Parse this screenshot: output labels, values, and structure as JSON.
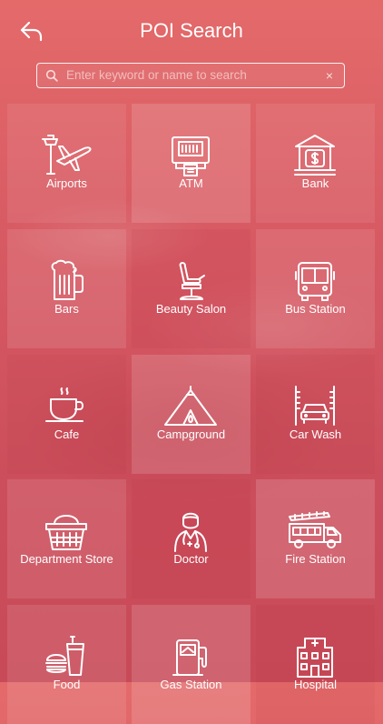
{
  "header": {
    "title": "POI Search"
  },
  "search": {
    "placeholder": "Enter keyword or name to search",
    "clear_glyph": "×"
  },
  "categories": [
    {
      "label": "Airports",
      "icon": "airport-icon"
    },
    {
      "label": "ATM",
      "icon": "atm-icon"
    },
    {
      "label": "Bank",
      "icon": "bank-icon"
    },
    {
      "label": "Bars",
      "icon": "beer-mug-icon"
    },
    {
      "label": "Beauty Salon",
      "icon": "salon-chair-icon"
    },
    {
      "label": "Bus Station",
      "icon": "bus-icon"
    },
    {
      "label": "Cafe",
      "icon": "coffee-cup-icon"
    },
    {
      "label": "Campground",
      "icon": "tent-icon"
    },
    {
      "label": "Car Wash",
      "icon": "car-wash-icon"
    },
    {
      "label": "Department Store",
      "icon": "basket-icon"
    },
    {
      "label": "Doctor",
      "icon": "doctor-icon"
    },
    {
      "label": "Fire Station",
      "icon": "fire-truck-icon"
    },
    {
      "label": "Food",
      "icon": "food-icon"
    },
    {
      "label": "Gas Station",
      "icon": "gas-pump-icon"
    },
    {
      "label": "Hospital",
      "icon": "hospital-icon"
    }
  ]
}
